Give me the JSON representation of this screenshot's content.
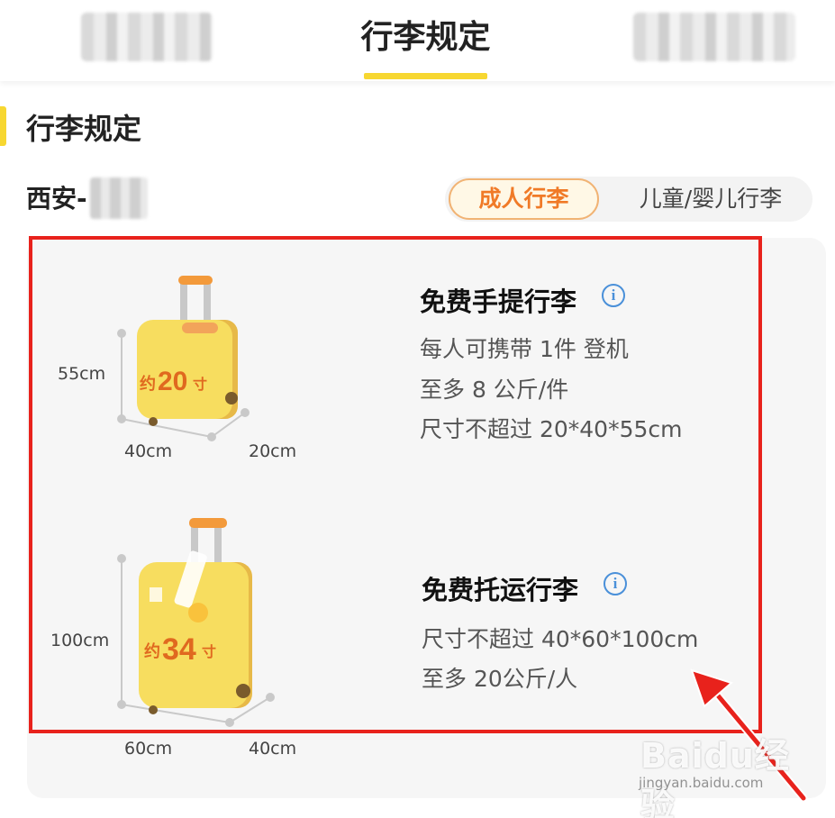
{
  "header": {
    "tabs": [
      {
        "label": "",
        "blurred": true
      },
      {
        "label": "行李规定",
        "active": true
      },
      {
        "label": "",
        "blurred": true
      }
    ],
    "accent_color": "#f7d731"
  },
  "section": {
    "title": "行李规定"
  },
  "route": {
    "from": "西安-",
    "to_blurred": true
  },
  "toggle": {
    "options": [
      "成人行李",
      "儿童/婴儿行李"
    ],
    "selected": "成人行李",
    "selected_color": "#f07a27"
  },
  "carry_on": {
    "title": "免费手提行李",
    "icon": "info-icon",
    "lines": [
      "每人可携带 1件 登机",
      "至多 8 公斤/件",
      "尺寸不超过 20*40*55cm"
    ],
    "bag_label_prefix": "约",
    "bag_label_size": "20",
    "bag_label_unit": "寸",
    "dims": {
      "height": "55cm",
      "width": "40cm",
      "depth": "20cm"
    }
  },
  "checked": {
    "title": "免费托运行李",
    "icon": "info-icon",
    "lines": [
      "尺寸不超过 40*60*100cm",
      "至多 20公斤/人"
    ],
    "bag_label_prefix": "约",
    "bag_label_size": "34",
    "bag_label_unit": "寸",
    "dims": {
      "height": "100cm",
      "width": "60cm",
      "depth": "40cm"
    }
  },
  "annotation": {
    "highlight_color": "#e8221c"
  },
  "watermark": {
    "main": "Baidu经验",
    "sub": "jingyan.baidu.com"
  }
}
